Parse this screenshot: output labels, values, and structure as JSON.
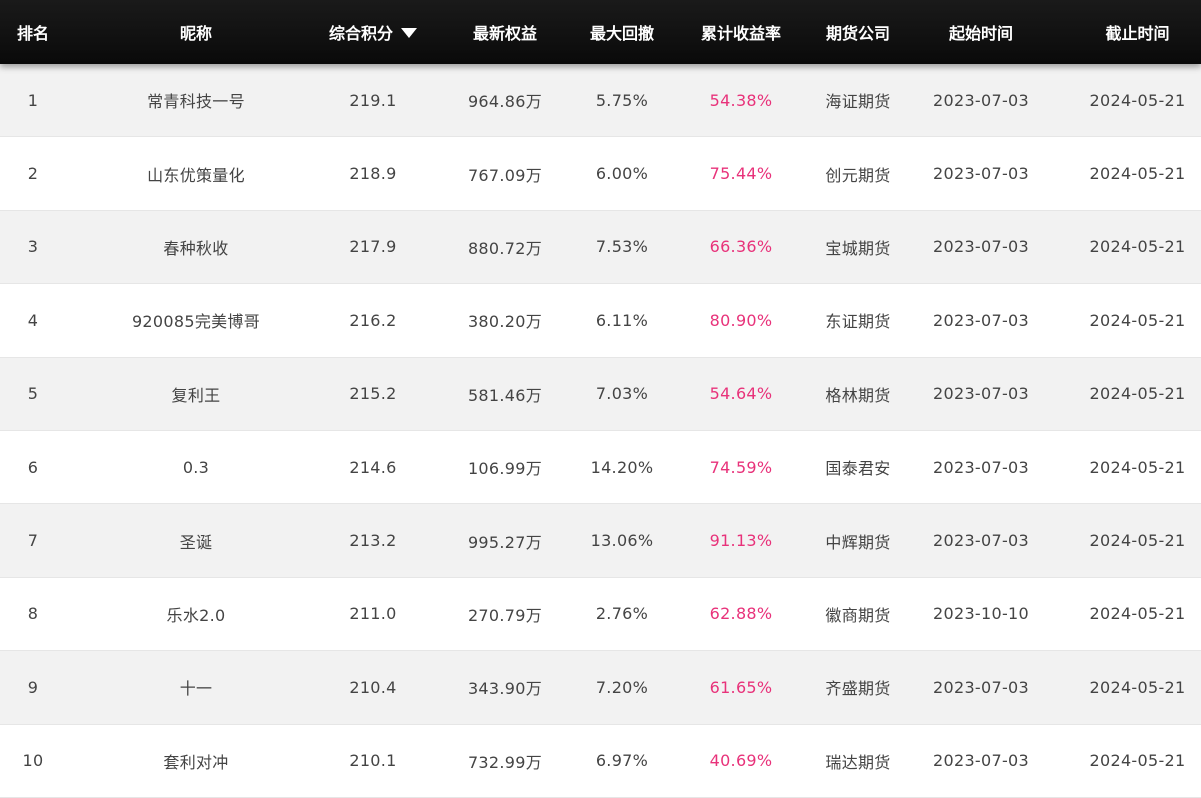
{
  "columns": {
    "rank": "排名",
    "nickname": "昵称",
    "score": "综合积分",
    "equity": "最新权益",
    "drawdown": "最大回撤",
    "return": "累计收益率",
    "company": "期货公司",
    "start": "起始时间",
    "end": "截止时间"
  },
  "colors": {
    "header_bg": "#111111",
    "header_text": "#ffffff",
    "row_alt_bg": "#f2f2f2",
    "text": "#444444",
    "return_accent": "#e8327a"
  },
  "icons": {
    "sort": "sort-descending-triangle"
  },
  "rows": [
    {
      "rank": "1",
      "nickname": "常青科技一号",
      "score": "219.1",
      "equity": "964.86万",
      "drawdown": "5.75%",
      "return": "54.38%",
      "company": "海证期货",
      "start": "2023-07-03",
      "end": "2024-05-21"
    },
    {
      "rank": "2",
      "nickname": "山东优策量化",
      "score": "218.9",
      "equity": "767.09万",
      "drawdown": "6.00%",
      "return": "75.44%",
      "company": "创元期货",
      "start": "2023-07-03",
      "end": "2024-05-21"
    },
    {
      "rank": "3",
      "nickname": "春种秋收",
      "score": "217.9",
      "equity": "880.72万",
      "drawdown": "7.53%",
      "return": "66.36%",
      "company": "宝城期货",
      "start": "2023-07-03",
      "end": "2024-05-21"
    },
    {
      "rank": "4",
      "nickname": "920085完美博哥",
      "score": "216.2",
      "equity": "380.20万",
      "drawdown": "6.11%",
      "return": "80.90%",
      "company": "东证期货",
      "start": "2023-07-03",
      "end": "2024-05-21"
    },
    {
      "rank": "5",
      "nickname": "复利王",
      "score": "215.2",
      "equity": "581.46万",
      "drawdown": "7.03%",
      "return": "54.64%",
      "company": "格林期货",
      "start": "2023-07-03",
      "end": "2024-05-21"
    },
    {
      "rank": "6",
      "nickname": "0.3",
      "score": "214.6",
      "equity": "106.99万",
      "drawdown": "14.20%",
      "return": "74.59%",
      "company": "国泰君安",
      "start": "2023-07-03",
      "end": "2024-05-21"
    },
    {
      "rank": "7",
      "nickname": "圣诞",
      "score": "213.2",
      "equity": "995.27万",
      "drawdown": "13.06%",
      "return": "91.13%",
      "company": "中辉期货",
      "start": "2023-07-03",
      "end": "2024-05-21"
    },
    {
      "rank": "8",
      "nickname": "乐水2.0",
      "score": "211.0",
      "equity": "270.79万",
      "drawdown": "2.76%",
      "return": "62.88%",
      "company": "徽商期货",
      "start": "2023-10-10",
      "end": "2024-05-21"
    },
    {
      "rank": "9",
      "nickname": "十一",
      "score": "210.4",
      "equity": "343.90万",
      "drawdown": "7.20%",
      "return": "61.65%",
      "company": "齐盛期货",
      "start": "2023-07-03",
      "end": "2024-05-21"
    },
    {
      "rank": "10",
      "nickname": "套利对冲",
      "score": "210.1",
      "equity": "732.99万",
      "drawdown": "6.97%",
      "return": "40.69%",
      "company": "瑞达期货",
      "start": "2023-07-03",
      "end": "2024-05-21"
    }
  ]
}
